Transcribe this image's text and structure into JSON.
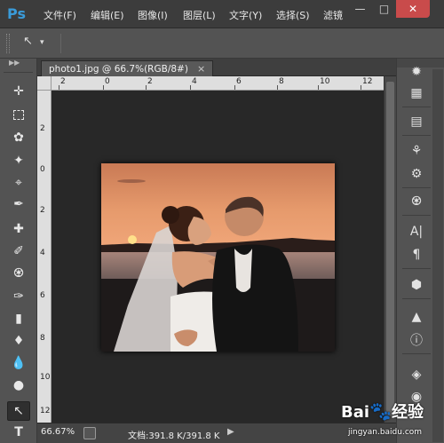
{
  "app": {
    "logo": "Ps",
    "menu": [
      "文件(F)",
      "编辑(E)",
      "图像(I)",
      "图层(L)",
      "文字(Y)",
      "选择(S)",
      "滤镜"
    ],
    "window_controls": [
      "minimize-icon",
      "restore-icon",
      "close-icon"
    ]
  },
  "options_bar": {
    "tool_icon": "path-selection-icon",
    "dropdown": "▾"
  },
  "document": {
    "tab_title": "photo1.jpg @ 66.7%(RGB/8#)",
    "tab_close": "×",
    "ruler_h_labels": [
      "2",
      "0",
      "2",
      "4",
      "6",
      "8",
      "10",
      "12"
    ],
    "ruler_v_labels": [
      "2",
      "0",
      "2",
      "4",
      "6",
      "8",
      "10",
      "12"
    ]
  },
  "status_bar": {
    "zoom": "66.67%",
    "doc_info": "文档:391.8 K/391.8 K",
    "arrow": "▶"
  },
  "toolbar": {
    "tools": [
      "move-icon",
      "marquee-icon",
      "lasso-icon",
      "magic-wand-icon",
      "crop-icon",
      "eyedropper-icon",
      "healing-brush-icon",
      "brush-icon",
      "clone-stamp-icon",
      "history-brush-icon",
      "eraser-icon",
      "paint-bucket-icon",
      "blur-icon",
      "dodge-icon",
      "path-selection-icon",
      "type-icon"
    ],
    "type_glyph": "T"
  },
  "right_dock": {
    "buttons": [
      "color-wheel-icon",
      "histogram-icon",
      "adjustments-icon",
      "brush-presets-icon",
      "clone-source-icon",
      "character-icon",
      "paragraph-icon",
      "3d-icon",
      "layer-comps-icon",
      "info-icon",
      "layers-icon",
      "channels-icon"
    ],
    "character_glyph": "A|",
    "paragraph_glyph": "¶"
  },
  "watermark": {
    "brand": "Bai",
    "brand_cn": "经验",
    "url": "jingyan.baidu.com"
  },
  "colors": {
    "accent": "#3a9bd9",
    "close_button": "#c94b4b",
    "canvas_bg": "#282828"
  }
}
